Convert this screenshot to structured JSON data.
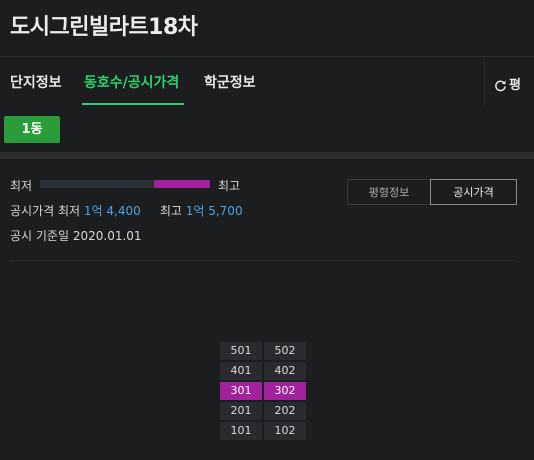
{
  "header": {
    "title": "도시그린빌라트18차"
  },
  "tabs": [
    {
      "label": "단지정보",
      "active": false
    },
    {
      "label": "동호수/공시가격",
      "active": true
    },
    {
      "label": "학군정보",
      "active": false
    }
  ],
  "refresh": {
    "icon": "refresh-icon",
    "label": "평"
  },
  "dong": {
    "label": "1동"
  },
  "price_range": {
    "low_label": "최저",
    "high_label": "최고",
    "highlight_start_fraction": 0.67,
    "highlight_end_fraction": 1.0
  },
  "price_info": {
    "prefix": "공시가격 최저",
    "low_value": "1억 4,400",
    "high_label": "최고",
    "high_value": "1억 5,700"
  },
  "base_date": {
    "label": "공시 기준일",
    "value": "2020.01.01"
  },
  "segmented": {
    "option_a": "평형정보",
    "option_b": "공시가격",
    "selected": "option_b"
  },
  "units": [
    [
      "501",
      "502"
    ],
    [
      "401",
      "402"
    ],
    [
      "301",
      "302"
    ],
    [
      "201",
      "202"
    ],
    [
      "101",
      "102"
    ]
  ],
  "highlighted_units": [
    "301",
    "302"
  ],
  "colors": {
    "accent_green": "#2fd06e",
    "button_green": "#2a9c3a",
    "highlight_magenta": "#a1229c",
    "price_blue": "#4aa3e6"
  }
}
